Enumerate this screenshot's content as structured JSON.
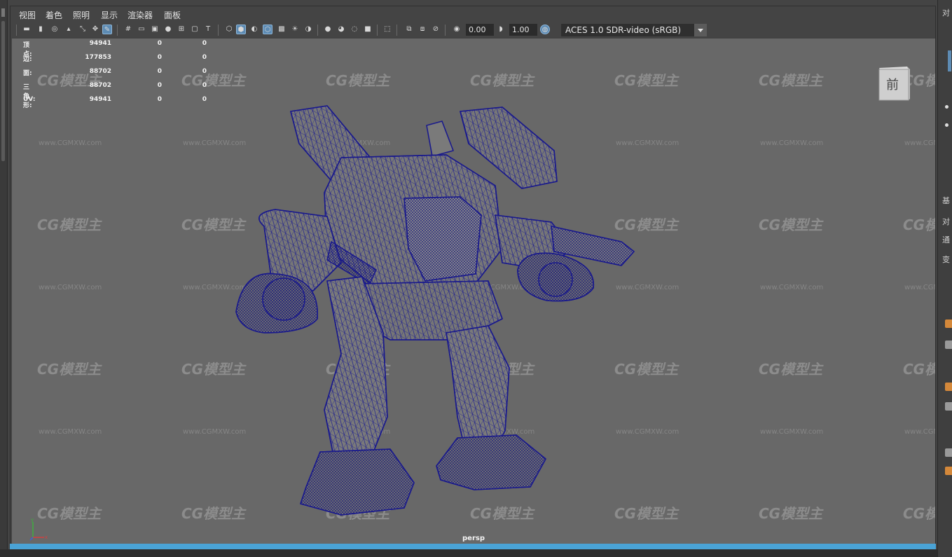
{
  "menu": [
    "视图",
    "着色",
    "照明",
    "显示",
    "渲染器",
    "面板"
  ],
  "toolbar": {
    "exposure": "0.00",
    "gamma": "1.00",
    "color_management": "ACES 1.0 SDR-video (sRGB)",
    "accent_color": "#5d8bb3"
  },
  "hud": {
    "rows": [
      {
        "label": "顶点:",
        "v1": "94941",
        "v2": "0",
        "v3": "0"
      },
      {
        "label": "边:",
        "v1": "177853",
        "v2": "0",
        "v3": "0"
      },
      {
        "label": "面:",
        "v1": "88702",
        "v2": "0",
        "v3": "0"
      },
      {
        "label": "三角形:",
        "v1": "88702",
        "v2": "0",
        "v3": "0"
      },
      {
        "label": "UV:",
        "v1": "94941",
        "v2": "0",
        "v3": "0"
      }
    ]
  },
  "view_cube": {
    "face_label": "前"
  },
  "camera_label": "persp",
  "watermark": {
    "logo": "CG模型主",
    "url": "www.CGMXW.com"
  },
  "right_panel": {
    "labels": [
      "对",
      "基",
      "对",
      "通",
      "变"
    ]
  },
  "colors": {
    "wireframe": "#1a1a8c",
    "viewport_bg": "#686868",
    "timebar": "#4aa3d6"
  }
}
